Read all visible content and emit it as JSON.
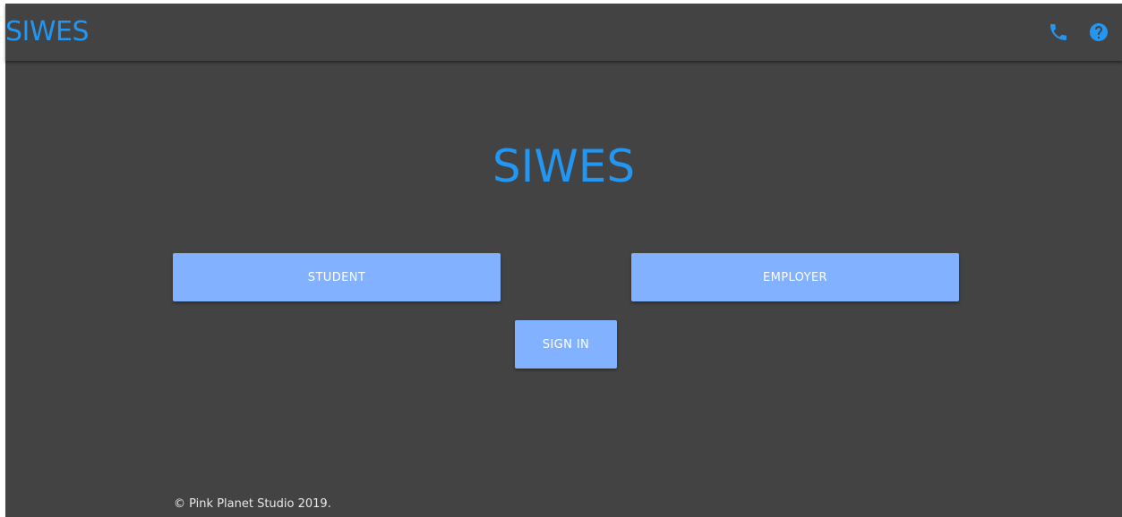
{
  "navbar": {
    "brand": "SIWES",
    "icons": [
      {
        "name": "phone-icon",
        "color": "#2196f3"
      },
      {
        "name": "help-icon",
        "color": "#2196f3"
      }
    ]
  },
  "main": {
    "title": "SIWES",
    "buttons": {
      "student": "STUDENT",
      "employer": "EMPLOYER",
      "sign_in": "SIGN IN"
    }
  },
  "footer": {
    "text": "© Pink Planet Studio 2019."
  },
  "colors": {
    "background": "#434343",
    "accent": "#2196f3",
    "button": "#82b1ff",
    "button_text": "#ffffff"
  }
}
